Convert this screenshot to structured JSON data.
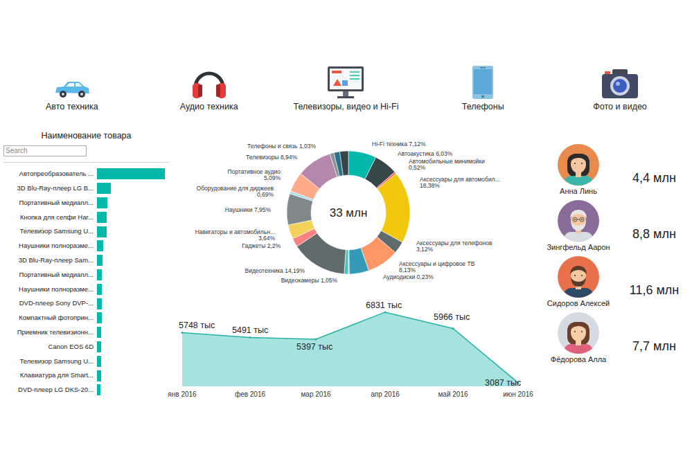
{
  "categories": [
    {
      "label": "Авто техника"
    },
    {
      "label": "Аудио техника"
    },
    {
      "label": "Телевизоры, видео и Hi-Fi"
    },
    {
      "label": "Телефоны"
    },
    {
      "label": "Фото и видео"
    }
  ],
  "products": {
    "title": "Наименование товара",
    "search": {
      "placeholder": "Search"
    },
    "items": [
      {
        "label": "Автопреобразователь ...",
        "level": 1.0
      },
      {
        "label": "3D Blu-Ray-плеер LG B...",
        "level": 0.2
      },
      {
        "label": "Портативный медиапл...",
        "level": 0.15
      },
      {
        "label": "Кнопка для селфи Har...",
        "level": 0.14
      },
      {
        "label": "Телевизор Samsung U...",
        "level": 0.14
      },
      {
        "label": "Наушники полноразме...",
        "level": 0.09
      },
      {
        "label": "3D Blu-Ray-плеер Sam...",
        "level": 0.08
      },
      {
        "label": "Портативный медиапл...",
        "level": 0.07
      },
      {
        "label": "Наушники полноразме...",
        "level": 0.07
      },
      {
        "label": "DVD-плеер Sony DVP-...",
        "level": 0.07
      },
      {
        "label": "Компактный фотоприн...",
        "level": 0.07
      },
      {
        "label": "Приемник телевизионн...",
        "level": 0.065
      },
      {
        "label": "Canon EOS 6D",
        "level": 0.06
      },
      {
        "label": "Телевизор Samsung U...",
        "level": 0.06
      },
      {
        "label": "Клавиатура для Smart...",
        "level": 0.06
      },
      {
        "label": "DVD-плеер LG DKS-20...",
        "level": 0.05
      }
    ]
  },
  "donut": {
    "center": "33 млн",
    "slices": [
      {
        "label": "Hi-Fi техника",
        "pct": "7,12%",
        "value": 7.12,
        "color": "#01b8aa"
      },
      {
        "label": "Автоакустика",
        "pct": "6,03%",
        "value": 6.03,
        "color": "#374649"
      },
      {
        "label": "Автомобильные минимойки",
        "pct": "0,52%",
        "value": 0.52,
        "color": "#fd625e"
      },
      {
        "label": "Аксессуары для автомобил...",
        "pct": "18,38%",
        "value": 18.38,
        "color": "#f2c80f"
      },
      {
        "label": "Аксессуары для телефонов",
        "pct": "3,12%",
        "value": 3.12,
        "color": "#5f6b6d"
      },
      {
        "label": "Аксессуары и цифровое ТВ",
        "pct": "8,13%",
        "value": 8.13,
        "color": "#fe9666"
      },
      {
        "value": 5.0,
        "color": "#3599b8"
      },
      {
        "label": "Аудиодиски",
        "pct": "0,23%",
        "value": 0.23,
        "color": "#dfbfbf"
      },
      {
        "label": "Видеокамеры",
        "pct": "1,05%",
        "value": 1.05,
        "color": "#4ac5bb"
      },
      {
        "label": "Видеотехника",
        "pct": "14,19%",
        "value": 14.19,
        "color": "#5f6b6d"
      },
      {
        "label": "Гаджеты",
        "pct": "2,2%",
        "value": 2.2,
        "color": "#fb8281"
      },
      {
        "label": "Навигаторы и автомобильн...",
        "pct": "3,64%",
        "value": 3.64,
        "color": "#f4d25a"
      },
      {
        "label": "Наушники",
        "pct": "7,95%",
        "value": 7.95,
        "color": "#7f898a"
      },
      {
        "label": "Оборудование для диджеев",
        "pct": "0,69%",
        "value": 0.69,
        "color": "#a4ddee"
      },
      {
        "label": "Портативное аудио",
        "pct": "5,09%",
        "value": 5.09,
        "color": "#fdab89"
      },
      {
        "label": "Телевизоры",
        "pct": "8,94%",
        "value": 8.94,
        "color": "#b687ac"
      },
      {
        "label": "Телефоны и связь",
        "pct": "1,03%",
        "value": 1.03,
        "color": "#8a9394"
      },
      {
        "value": 1.5,
        "color": "#28738a"
      },
      {
        "value": 2.19,
        "color": "#374649"
      }
    ]
  },
  "trend": {
    "values": [
      5748,
      5491,
      5397,
      6831,
      5966,
      3087
    ],
    "labels": [
      "5748 тыс",
      "5491 тыс",
      "5397 тыс",
      "6831 тыс",
      "5966 тыс",
      "3087 тыс"
    ],
    "months": [
      "янв 2016",
      "фев 2016",
      "мар 2016",
      "апр 2016",
      "май 2016",
      "июн 2016"
    ]
  },
  "people": [
    {
      "name": "Анна Линь",
      "value": "4,4 млн",
      "color": "#e88a4e"
    },
    {
      "name": "Зингфельд Аарон",
      "value": "8,8 млн",
      "color": "#8a6c9a"
    },
    {
      "name": "Сидоров Алексей",
      "value": "11,6 млн",
      "color": "#e8704b"
    },
    {
      "name": "Фёдорова Алла",
      "value": "7,7 млн",
      "color": "#d6dbe3"
    }
  ]
}
